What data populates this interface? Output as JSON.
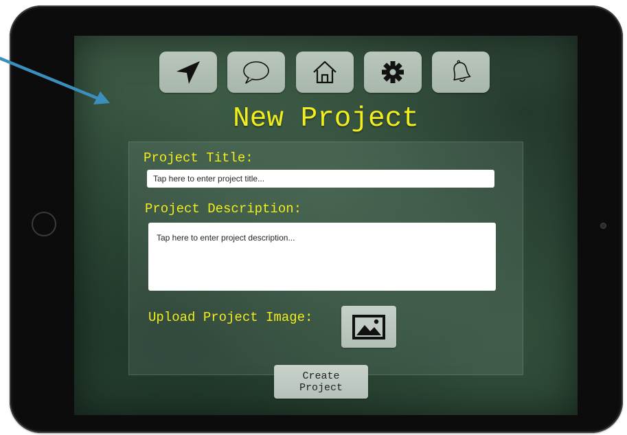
{
  "toolbar": {
    "items": [
      {
        "icon": "navigation-arrow-icon"
      },
      {
        "icon": "chat-bubble-icon"
      },
      {
        "icon": "home-icon"
      },
      {
        "icon": "gear-icon"
      },
      {
        "icon": "bell-icon"
      }
    ]
  },
  "page": {
    "title": "New Project"
  },
  "form": {
    "title_label": "Project Title:",
    "title_placeholder": "Tap here to enter project title...",
    "description_label": "Project Description:",
    "description_placeholder": "Tap here to enter project description...",
    "image_label": "Upload Project Image:",
    "image_icon": "image-icon",
    "create_label": "Create\nProject"
  },
  "colors": {
    "accent_text": "#f2ee1d",
    "annotation_arrow": "#3a8fbd",
    "background": "#35523e"
  }
}
